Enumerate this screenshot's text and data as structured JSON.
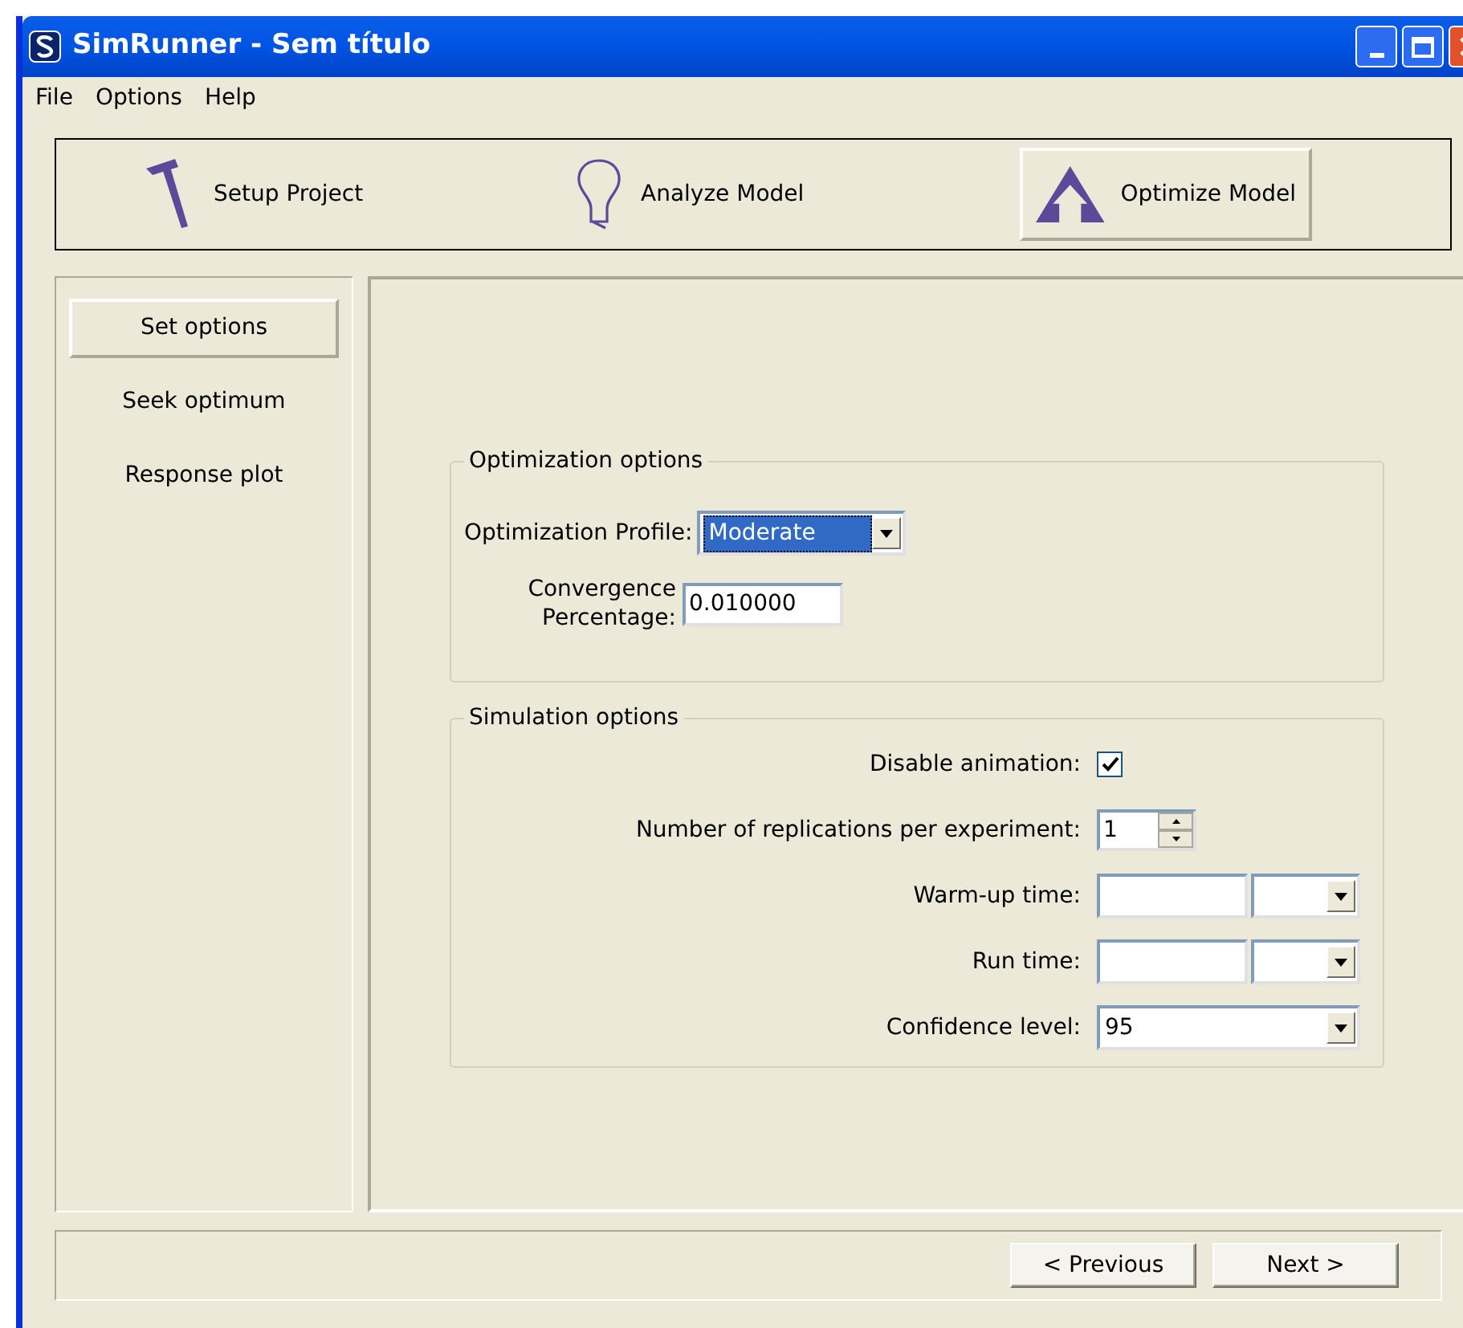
{
  "window": {
    "title": "SimRunner - Sem título"
  },
  "menu": [
    "File",
    "Options",
    "Help"
  ],
  "steps": [
    {
      "label": "Setup Project",
      "kind": "hammer",
      "selected": false
    },
    {
      "label": "Analyze Model",
      "kind": "bulb",
      "selected": false
    },
    {
      "label": "Optimize Model",
      "kind": "peak",
      "selected": true
    }
  ],
  "sidebar": {
    "items": [
      {
        "label": "Set options",
        "selected": true
      },
      {
        "label": "Seek optimum",
        "selected": false
      },
      {
        "label": "Response plot",
        "selected": false
      }
    ]
  },
  "optimization_options": {
    "title": "Optimization options",
    "profile": {
      "label": "Optimization Profile:",
      "value": "Moderate",
      "focused": true
    },
    "convergence": {
      "label": "Convergence Percentage:",
      "value": "0.010000"
    }
  },
  "simulation_options": {
    "title": "Simulation options",
    "rows": [
      {
        "kind": "checkbox",
        "label": "Disable animation:",
        "checked": true
      },
      {
        "kind": "spinner",
        "label": "Number of replications per experiment:",
        "value": "1"
      },
      {
        "kind": "time",
        "label": "Warm-up time:"
      },
      {
        "kind": "time",
        "label": "Run time:"
      },
      {
        "kind": "dropdown",
        "label": "Confidence level:",
        "value": "95"
      }
    ]
  },
  "buttons": [
    "< Previous",
    "Next >"
  ]
}
